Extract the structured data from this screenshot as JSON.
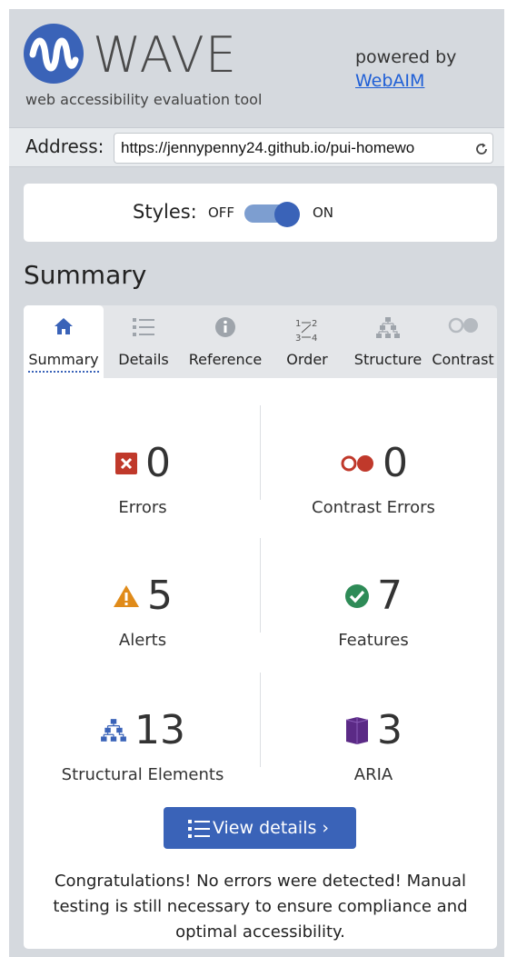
{
  "header": {
    "logo_text": "WAVE",
    "tagline": "web accessibility evaluation tool",
    "powered_by": "powered by",
    "webaim_link": "WebAIM"
  },
  "address": {
    "label": "Address:",
    "value": "https://jennypenny24.github.io/pui-homewo",
    "reload_icon": "reload-icon"
  },
  "styles": {
    "label": "Styles:",
    "off": "OFF",
    "on": "ON",
    "state": "on"
  },
  "summary_heading": "Summary",
  "tabs": [
    {
      "label": "Summary",
      "icon": "home-icon",
      "active": true
    },
    {
      "label": "Details",
      "icon": "list-icon",
      "active": false
    },
    {
      "label": "Reference",
      "icon": "info-icon",
      "active": false
    },
    {
      "label": "Order",
      "icon": "order-icon",
      "active": false
    },
    {
      "label": "Structure",
      "icon": "structure-icon",
      "active": false
    },
    {
      "label": "Contrast",
      "icon": "contrast-icon",
      "active": false
    }
  ],
  "stats": {
    "errors": {
      "count": "0",
      "label": "Errors",
      "icon": "error-icon"
    },
    "contrast_errors": {
      "count": "0",
      "label": "Contrast Errors",
      "icon": "contrast-error-icon"
    },
    "alerts": {
      "count": "5",
      "label": "Alerts",
      "icon": "alert-icon"
    },
    "features": {
      "count": "7",
      "label": "Features",
      "icon": "feature-check-icon"
    },
    "structural": {
      "count": "13",
      "label": "Structural Elements",
      "icon": "structure-icon"
    },
    "aria": {
      "count": "3",
      "label": "ARIA",
      "icon": "aria-icon"
    }
  },
  "view_details_label": "View details ›",
  "congrats": "Congratulations! No errors were detected! Manual testing is still necessary to ensure compliance and optimal accessibility.",
  "colors": {
    "brand_blue": "#3a63b8",
    "error_red": "#c0392b",
    "alert_orange": "#e08b1a",
    "feature_green": "#2e8b57",
    "aria_purple": "#5b2a86"
  }
}
